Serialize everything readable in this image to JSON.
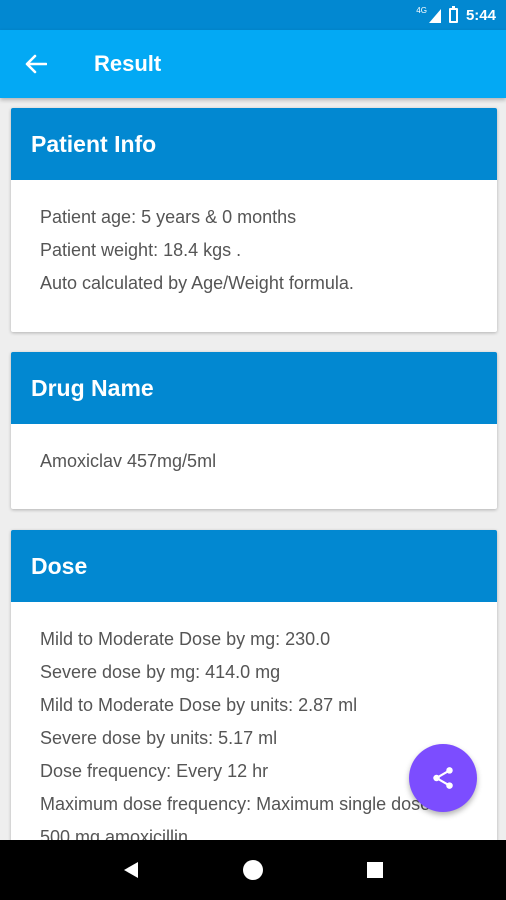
{
  "status_bar": {
    "network": "4G",
    "time": "5:44"
  },
  "app_bar": {
    "title": "Result"
  },
  "cards": {
    "patient_info": {
      "title": "Patient Info",
      "lines": [
        "Patient age: 5 years & 0 months",
        "Patient weight: 18.4 kgs .",
        "Auto calculated by Age/Weight formula."
      ]
    },
    "drug_name": {
      "title": "Drug Name",
      "lines": [
        "Amoxiclav 457mg/5ml"
      ]
    },
    "dose": {
      "title": "Dose",
      "lines": [
        "Mild to Moderate Dose by mg:  230.0",
        "Severe dose by mg: 414.0 mg",
        "Mild to Moderate Dose by units: 2.87 ml",
        "Severe dose by units: 5.17 ml",
        "Dose frequency: Every 12 hr",
        "Maximum dose frequency: Maximum single dose:",
        "500 mg amoxicillin"
      ]
    }
  },
  "icons": {
    "back": "arrow-left-icon",
    "share": "share-icon",
    "nav_back": "triangle-back-icon",
    "nav_home": "circle-home-icon",
    "nav_recents": "square-recents-icon"
  },
  "colors": {
    "status_bar": "#0288d1",
    "app_bar": "#03a9f4",
    "card_header": "#0288d1",
    "fab": "#7c4dff",
    "background": "#eeeeee"
  }
}
